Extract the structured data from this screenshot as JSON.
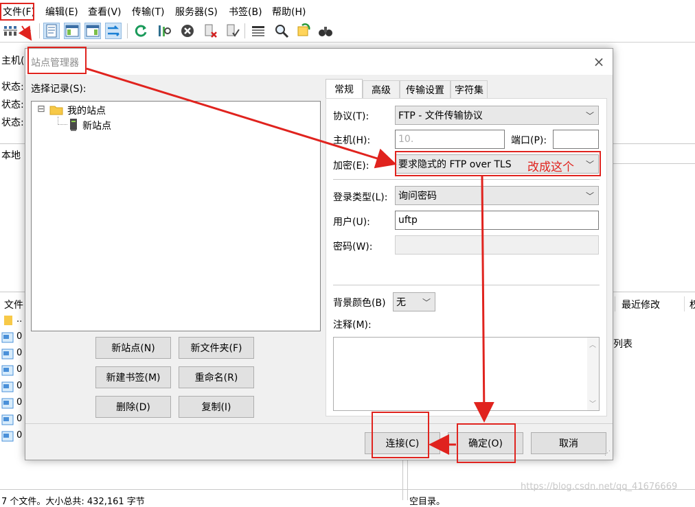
{
  "menubar": {
    "items": [
      "文件(F)",
      "编辑(E)",
      "查看(V)",
      "传输(T)",
      "服务器(S)",
      "书签(B)",
      "帮助(H)"
    ]
  },
  "toolbar": {
    "icons": [
      "site-manager-icon",
      "message-log-icon",
      "local-tree-icon",
      "remote-tree-icon",
      "transfer-queue-icon",
      "refresh-icon",
      "process-queue-icon",
      "cancel-icon",
      "disconnect-icon",
      "reconnect-icon",
      "directory-listing-filters-icon",
      "search-icon",
      "synchronized-browsing-icon",
      "find-files-icon"
    ]
  },
  "main": {
    "host_label": "主机(",
    "status_label": "状态:",
    "local_label": "本地",
    "file_col": "文件",
    "last_modified_col": "最近修改",
    "col_cut": "权",
    "list_text": "列表",
    "file_rows": [
      "..",
      "0",
      "0",
      "0",
      "0",
      "0",
      "0",
      "0"
    ],
    "status_left": "7 个文件。大小总共: 432,161 字节",
    "status_right": "空目录。",
    "watermark": "https://blog.csdn.net/qq_41676669"
  },
  "dialog": {
    "title": "站点管理器",
    "close": "×",
    "select_entry": "选择记录(S):",
    "tree": {
      "root_label": "我的站点",
      "child_label": "新站点",
      "expander": "⊟"
    },
    "buttons": {
      "new_site": "新站点(N)",
      "new_folder": "新文件夹(F)",
      "new_bookmark": "新建书签(M)",
      "rename": "重命名(R)",
      "delete": "删除(D)",
      "copy": "复制(I)",
      "connect": "连接(C)",
      "ok": "确定(O)",
      "cancel": "取消"
    },
    "tabs": [
      "常规",
      "高级",
      "传输设置",
      "字符集"
    ],
    "general": {
      "protocol_label": "协议(T):",
      "protocol_value": "FTP - 文件传输协议",
      "host_label": "主机(H):",
      "host_value": "10.",
      "port_label": "端口(P):",
      "port_value": "",
      "encryption_label": "加密(E):",
      "encryption_value": "要求隐式的 FTP over TLS",
      "logon_type_label": "登录类型(L):",
      "logon_type_value": "询问密码",
      "user_label": "用户(U):",
      "user_value": "uftp",
      "password_label": "密码(W):",
      "bg_color_label": "背景颜色(B)",
      "bg_color_value": "无",
      "comments_label": "注释(M):"
    },
    "annotation": "改成这个"
  },
  "colors": {
    "annotation": "#e0231e",
    "dialog_bg": "#f0f0f0",
    "button_bg": "#e1e1e1"
  }
}
